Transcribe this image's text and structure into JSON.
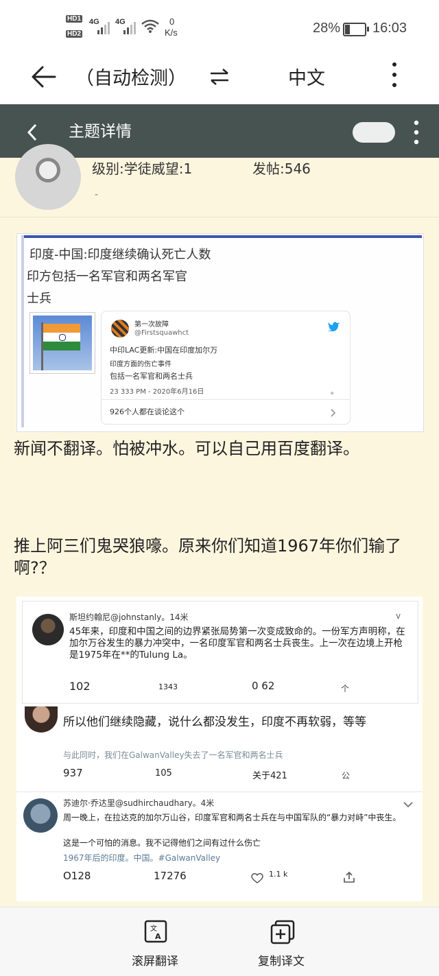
{
  "status": {
    "hd1": "HD1",
    "hd2": "HD2",
    "net1": "4G",
    "net2": "4G",
    "speed_value": "0",
    "speed_unit": "K/s",
    "battery": "28%",
    "time": "16:03"
  },
  "translate_bar": {
    "source_lang": "（自动检测）",
    "swap_icon": "swap-arrows-icon",
    "target_lang": "中文"
  },
  "header": {
    "title": "主题详情"
  },
  "user": {
    "level_label": "级别:学徒威望:1",
    "posts_label": "发帖:546",
    "dash": "-"
  },
  "tweet1": {
    "heading": "印度-中国:印度继续确认死亡人数",
    "line2": "印方包括一名军官和两名军官",
    "line3": "士兵",
    "account_name": "第一次故障",
    "handle": "@Firstsquawhct",
    "body1": "中印LAC更新:中国在印度加尔万",
    "body2": "印度方面的伤亡事件",
    "body3": "包括一名军官和两名士兵",
    "time": "23 333 PM - 2020年6月16日",
    "dot": "。",
    "discuss": "926个人都在谈论这个"
  },
  "post_text": {
    "p1": "新闻不翻译。怕被冲水。可以自己用百度翻译。",
    "p2": "推上阿三们鬼哭狼嚎。原来你们知道1967年你们输了啊?？"
  },
  "tweet2": {
    "name": "斯坦约翰尼@johnstanly。14米",
    "chevron": "v",
    "body": "45年来，印度和中国之间的边界紧张局势第一次变成致命的。一份军方声明称，在加尔万谷发生的暴力冲突中，一名印度军官和两名士兵丧生。上一次在边境上开枪是1975年在**的Tulung La。",
    "stat1": "102",
    "stat2": "1343",
    "stat3": "0 62",
    "stat4": "个"
  },
  "tweet3": {
    "body": "所以他们继续隐藏，说什么都没发生，印度不再软弱，等等",
    "sub": "与此同时，我们在GalwanValley失去了一名军官和两名士兵",
    "stat1": "937",
    "stat2": "105",
    "stat3": "关于421",
    "stat4": "公"
  },
  "tweet4": {
    "name": "苏迪尔·乔达里@sudhirchaudhary。4米",
    "body": "周一晚上，在拉达克的加尔万山谷，印度军官和两名士兵在与中国军队的“暴力对峙”中丧生。",
    "body2": "这是一个可怕的消息。我不记得他们之间有过什么伤亡",
    "tags": "1967年后的印度。中国。#GalwanValley",
    "stat1": "O128",
    "stat2": "17276",
    "likes": "1.1 k"
  },
  "bottom": {
    "btn1": "滚屏翻译",
    "btn2": "复制译文"
  }
}
